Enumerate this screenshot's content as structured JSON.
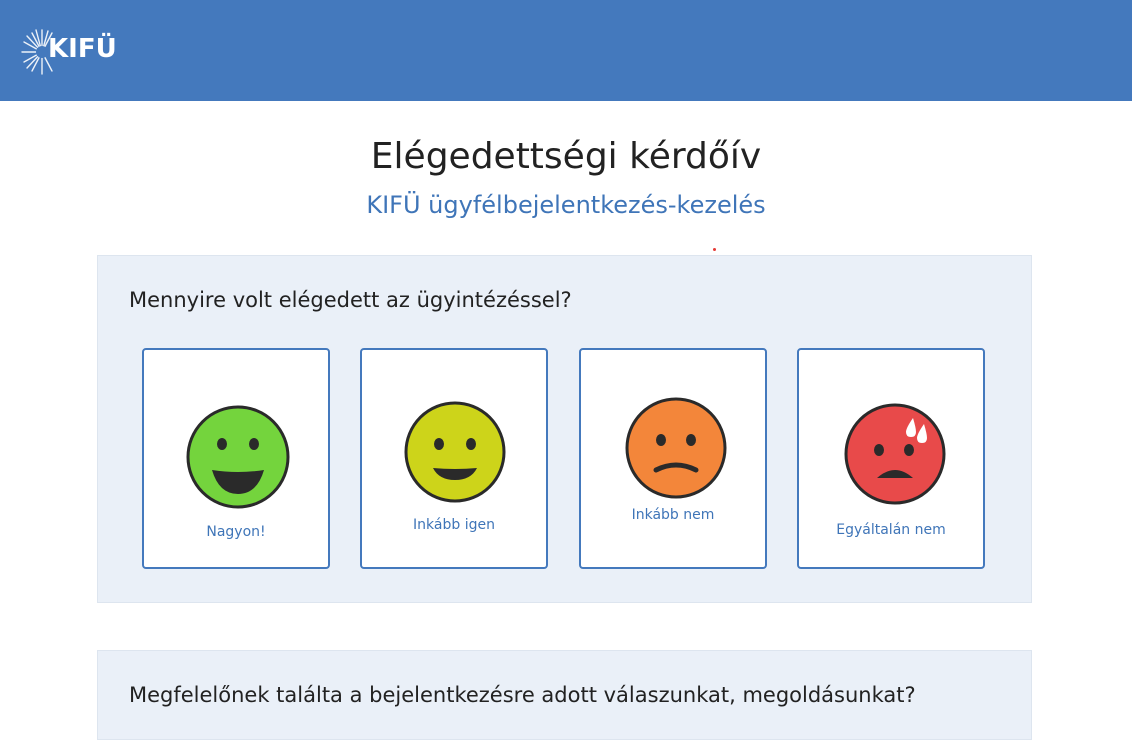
{
  "header": {
    "logo_text": "KIFÜ",
    "background_color": "#4479bd"
  },
  "page": {
    "title": "Elégedettségi kérdőív",
    "subtitle": "KIFÜ ügyfélbejelentkezés-kezelés"
  },
  "questions": [
    {
      "text": "Mennyire volt elégedett az ügyintézéssel?",
      "options": [
        {
          "label": "Nagyon!",
          "icon": "very-happy-face-icon",
          "color": "#74d43d"
        },
        {
          "label": "Inkább igen",
          "icon": "happy-face-icon",
          "color": "#cdd41a"
        },
        {
          "label": "Inkább nem",
          "icon": "unhappy-face-icon",
          "color": "#f3863a"
        },
        {
          "label": "Egyáltalán nem",
          "icon": "very-unhappy-face-icon",
          "color": "#e84a4a"
        }
      ]
    },
    {
      "text": "Megfelelőnek találta a bejelentkezésre adott válaszunkat, megoldásunkat?"
    }
  ]
}
